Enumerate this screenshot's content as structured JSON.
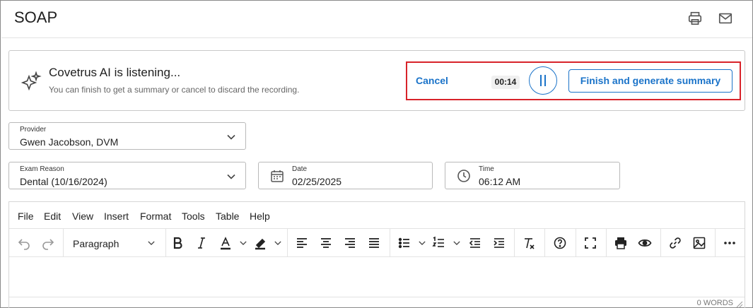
{
  "header": {
    "title": "SOAP",
    "icons": [
      "printer-icon",
      "mail-icon"
    ]
  },
  "ai_panel": {
    "icon": "sparkle-icon",
    "title": "Covetrus AI is listening...",
    "subtitle": "You can finish to get a summary or cancel to discard the recording.",
    "cancel_label": "Cancel",
    "timer": "00:14",
    "pause_icon": "pause-icon",
    "finish_label": "Finish and generate summary",
    "highlight_color": "#d8232a",
    "accent_color": "#1a73c9"
  },
  "form": {
    "provider": {
      "label": "Provider",
      "value": "Gwen Jacobson, DVM"
    },
    "exam_reason": {
      "label": "Exam Reason",
      "value": "Dental (10/16/2024)"
    },
    "date": {
      "label": "Date",
      "value": "02/25/2025",
      "icon": "calendar-icon"
    },
    "time": {
      "label": "Time",
      "value": "06:12 AM",
      "icon": "clock-icon"
    }
  },
  "editor": {
    "menu": [
      "File",
      "Edit",
      "View",
      "Insert",
      "Format",
      "Tools",
      "Table",
      "Help"
    ],
    "block_format": "Paragraph",
    "toolbar_icons": [
      "undo-icon",
      "redo-icon",
      "bold-icon",
      "italic-icon",
      "text-color-icon",
      "highlight-icon",
      "align-left-icon",
      "align-center-icon",
      "align-right-icon",
      "justify-icon",
      "bullet-list-icon",
      "numbered-list-icon",
      "outdent-icon",
      "indent-icon",
      "clear-format-icon",
      "help-icon",
      "fullscreen-icon",
      "print-icon",
      "preview-icon",
      "link-icon",
      "image-icon",
      "more-icon"
    ],
    "word_count": "0 WORDS"
  }
}
